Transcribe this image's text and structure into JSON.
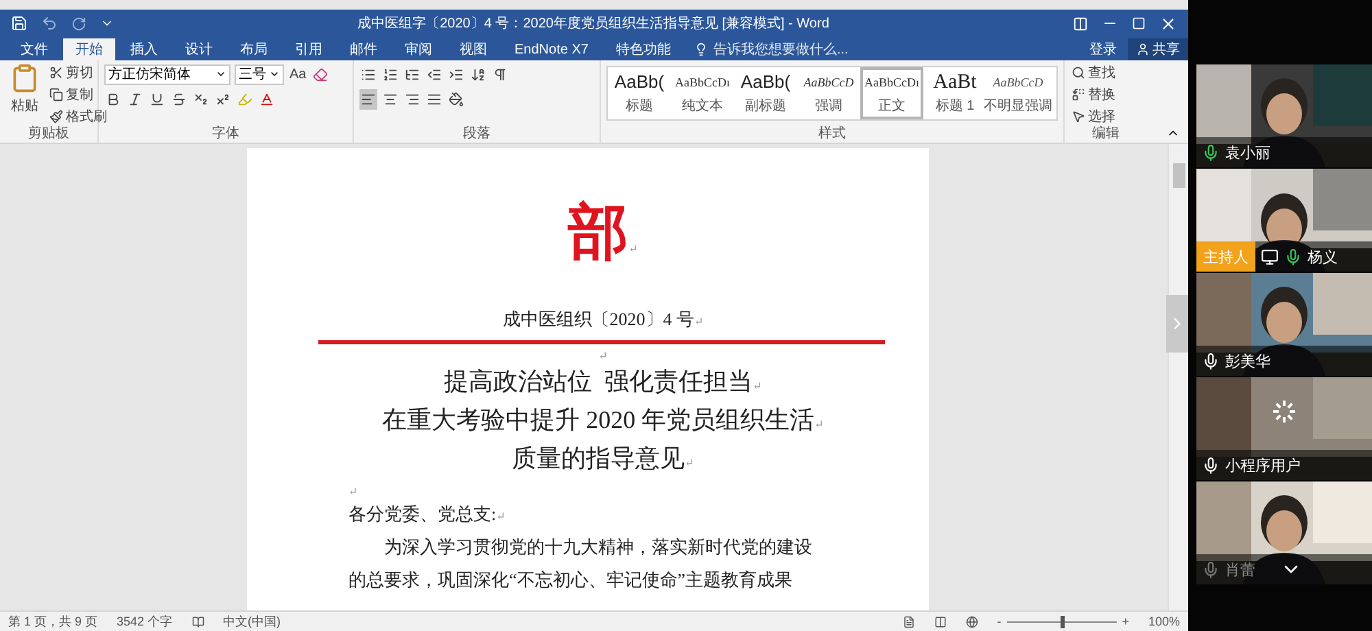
{
  "window": {
    "title": "成中医组字〔2020〕4 号：2020年度党员组织生活指导意见 [兼容模式] - Word"
  },
  "tabs": [
    {
      "label": "文件",
      "selected": false
    },
    {
      "label": "开始",
      "selected": true
    },
    {
      "label": "插入",
      "selected": false
    },
    {
      "label": "设计",
      "selected": false
    },
    {
      "label": "布局",
      "selected": false
    },
    {
      "label": "引用",
      "selected": false
    },
    {
      "label": "邮件",
      "selected": false
    },
    {
      "label": "审阅",
      "selected": false
    },
    {
      "label": "视图",
      "selected": false
    },
    {
      "label": "EndNote X7",
      "selected": false
    },
    {
      "label": "特色功能",
      "selected": false
    }
  ],
  "tell_me": {
    "placeholder": "告诉我您想要做什么..."
  },
  "account": {
    "sign_in": "登录",
    "share": "共享"
  },
  "ribbon": {
    "clipboard": {
      "label": "剪贴板",
      "paste": "粘贴",
      "items": [
        "剪切",
        "复制",
        "格式刷"
      ]
    },
    "font": {
      "label": "字体",
      "font_name": "方正仿宋简体",
      "font_size": "三号",
      "case_button": "Aa"
    },
    "paragraph": {
      "label": "段落",
      "align_buttons": [
        {
          "kind": "left",
          "selected": true
        },
        {
          "kind": "center",
          "selected": false
        },
        {
          "kind": "right",
          "selected": false
        },
        {
          "kind": "justify",
          "selected": false
        }
      ]
    },
    "styles": {
      "label": "样式",
      "items": [
        {
          "preview": "AaBb(",
          "name": "标题",
          "kind": "heading",
          "selected": false
        },
        {
          "preview": "AaBbCcDı",
          "name": "纯文本",
          "kind": "plain",
          "selected": false
        },
        {
          "preview": "AaBb(",
          "name": "副标题",
          "kind": "subtitle",
          "selected": false
        },
        {
          "preview": "AaBbCcD",
          "name": "强调",
          "kind": "emphasis",
          "selected": false
        },
        {
          "preview": "AaBbCcDı",
          "name": "正文",
          "kind": "normal",
          "selected": true
        },
        {
          "preview": "AaBt",
          "name": "标题 1",
          "kind": "heading1",
          "selected": false
        },
        {
          "preview": "AaBbCcD",
          "name": "不明显强调",
          "kind": "subtle",
          "selected": false
        }
      ]
    },
    "editing": {
      "label": "编辑",
      "items": [
        "查找",
        "替换",
        "选择"
      ]
    }
  },
  "document": {
    "paragraphs": [
      {
        "kind": "red_header",
        "text": "部",
        "end_mark": "↵"
      },
      {
        "kind": "doc_number",
        "text": "成中医组织〔2020〕4 号",
        "end_mark": "↵"
      },
      {
        "kind": "rule"
      },
      {
        "kind": "empty_center",
        "end_mark": "↵"
      },
      {
        "kind": "title",
        "text": "提高政治站位  强化责任担当",
        "end_mark": "↵"
      },
      {
        "kind": "title",
        "text": "在重大考验中提升 2020 年党员组织生活",
        "end_mark": "↵"
      },
      {
        "kind": "title",
        "text": "质量的指导意见",
        "end_mark": "↵"
      },
      {
        "kind": "empty",
        "end_mark": "↵"
      },
      {
        "kind": "salutation",
        "text": "各分党委、党总支:",
        "end_mark": "↵"
      },
      {
        "kind": "body",
        "text": "为深入学习贯彻党的十九大精神，落实新时代党的建设"
      },
      {
        "kind": "body_cont",
        "text": "的总要求，巩固深化“不忘初心、牢记使命”主题教育成果"
      }
    ]
  },
  "status_bar": {
    "page": "第 1 页，共 9 页",
    "words": "3542 个字",
    "language": "中文(中国)",
    "zoom_minus": "-",
    "zoom_plus": "+",
    "zoom": "100%",
    "zoom_slider": {
      "level": 0.5
    }
  },
  "participants": [
    {
      "name": "袁小丽",
      "speaking": true,
      "muted": false,
      "host": false,
      "loading": false,
      "more": false
    },
    {
      "name": "杨义",
      "speaking": true,
      "muted": false,
      "host": true,
      "host_label": "主持人",
      "loading": false,
      "more": false
    },
    {
      "name": "彭美华",
      "speaking": false,
      "muted": false,
      "host": false,
      "loading": false,
      "more": false
    },
    {
      "name": "小程序用户",
      "speaking": false,
      "muted": false,
      "host": false,
      "loading": true,
      "more": false
    },
    {
      "name": "肖蕾",
      "speaking": false,
      "muted": true,
      "host": false,
      "loading": false,
      "more": true
    }
  ]
}
